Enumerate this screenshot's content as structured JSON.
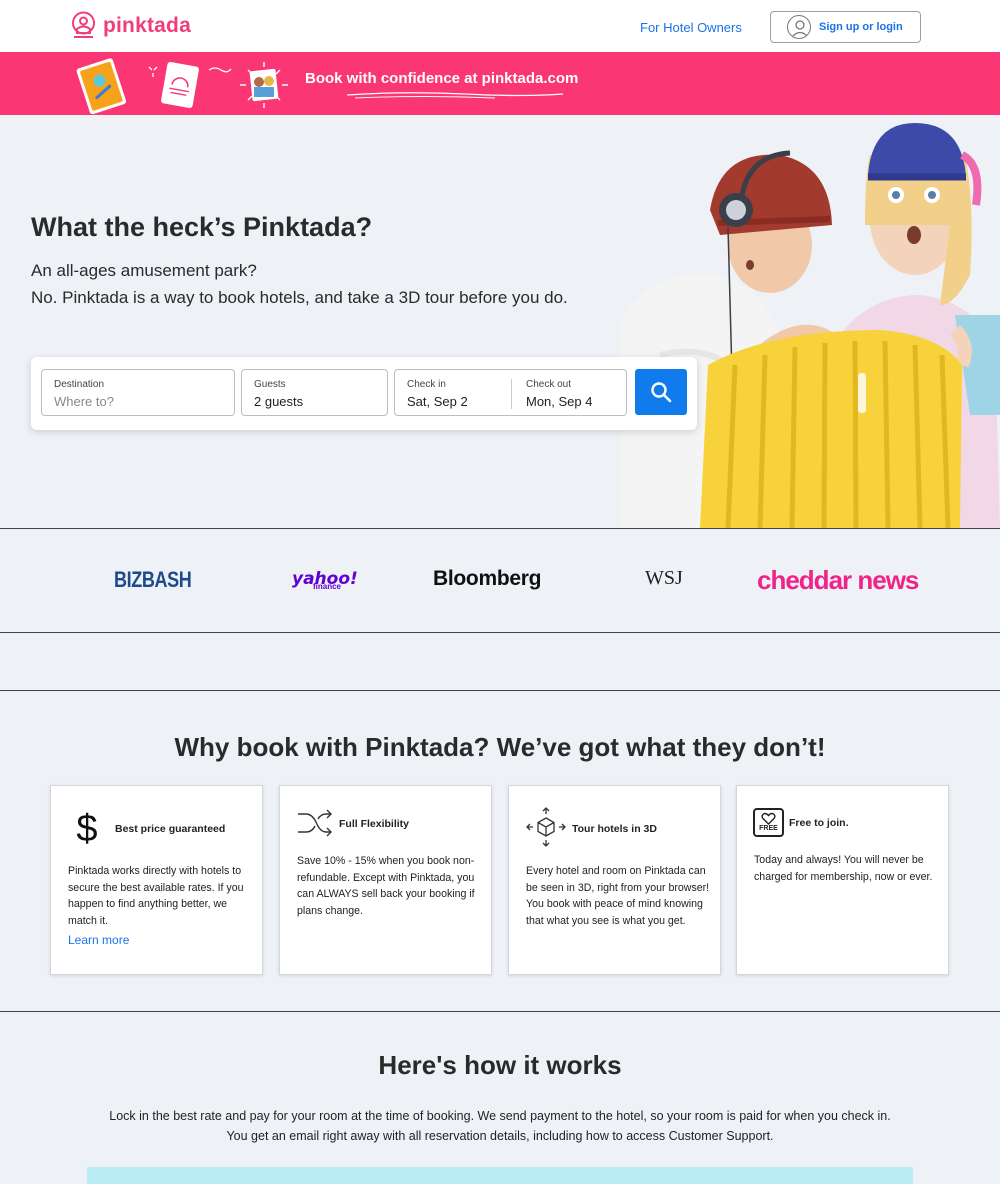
{
  "header": {
    "brand": "pinktada",
    "owners_link": "For Hotel Owners",
    "login_label": "Sign up or login"
  },
  "promo": {
    "text": "Book with confidence at pinktada.com"
  },
  "hero": {
    "title": "What the heck’s Pinktada?",
    "subtitle_line1": "An all-ages amusement park?",
    "subtitle_line2": "No. Pinktada is a way to book hotels, and take a 3D tour before you do."
  },
  "search": {
    "destination_label": "Destination",
    "destination_placeholder": "Where to?",
    "guests_label": "Guests",
    "guests_value": "2 guests",
    "checkin_label": "Check in",
    "checkin_value": "Sat, Sep 2",
    "checkout_label": "Check out",
    "checkout_value": "Mon, Sep 4"
  },
  "press": {
    "bizbash": "BIZBASH",
    "yahoo": "yahoo!",
    "yahoo_sub": "finance",
    "bloomberg": "Bloomberg",
    "wsj": "WSJ",
    "cheddar": "cheddar news"
  },
  "features": {
    "title": "Why book with Pinktada? We’ve got what they don’t!",
    "cards": [
      {
        "title": "Best price guaranteed",
        "icon": "dollar-icon",
        "body": "Pinktada works directly with hotels to secure the best available rates. If you happen to find anything better, we match it.",
        "link": "Learn more"
      },
      {
        "title": "Full Flexibility",
        "icon": "shuffle-icon",
        "body": "Save 10% - 15% when you book non-refundable. Except with Pinktada, you can ALWAYS sell back your booking if plans change."
      },
      {
        "title": "Tour hotels in 3D",
        "icon": "cube-3d-icon",
        "body": "Every hotel and room on Pinktada can be seen in 3D, right from your browser! You book with peace of mind knowing that what you see is what you get."
      },
      {
        "title": "Free to join.",
        "icon": "free-heart-icon",
        "icon_text": "FREE",
        "body": "Today and always! You will never be charged for membership, now or ever."
      }
    ]
  },
  "how": {
    "title": "Here's how it works",
    "line1": "Lock in the best rate and pay for your room at the time of booking. We send payment to the hotel, so your room is paid for when you check in.",
    "line2": "You get an email right away with all reservation details, including how to access Customer Support."
  },
  "colors": {
    "brand_pink": "#fb3675",
    "link_blue": "#1a73e8",
    "search_blue": "#0f7bec"
  }
}
